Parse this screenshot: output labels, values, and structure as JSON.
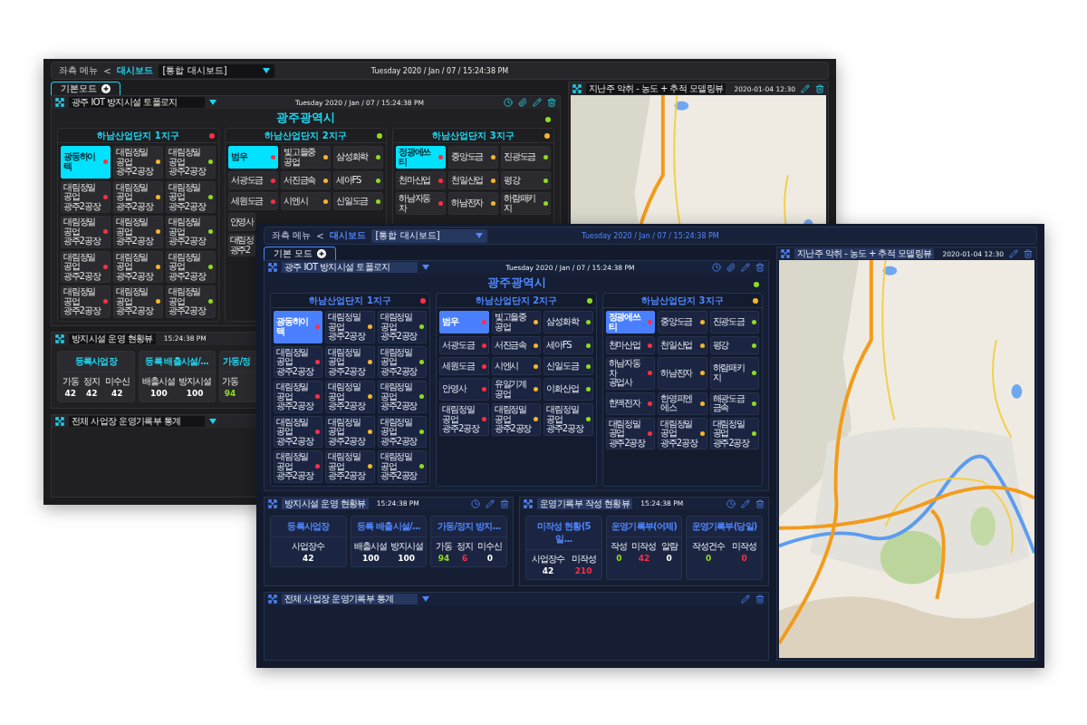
{
  "windows": [
    {
      "kind": "graphite",
      "header": {
        "menu": "좌측 메뉴",
        "separator": "<",
        "crumb": "대시보드",
        "dashboard": "[통합 대시보드]",
        "datetime": "Tuesday 2020 / Jan / 07 / 15:24:38 PM"
      },
      "tabs": [
        {
          "label": "기본모드",
          "selected": true
        }
      ],
      "topology": {
        "title": "광주 IOT 방지시설 토폴로지",
        "datetime": "Tuesday 2020 / Jan / 07 / 15:24:38 PM",
        "region": "광주광역시",
        "color": "#8fdc1e",
        "zones": [
          {
            "title": "하남산업단지 1지구",
            "color": "#ff2e45",
            "rows": [
              [
                {
                  "label": "광동하이텍",
                  "color": "#ff2e45",
                  "selected": true
                },
                {
                  "label": "대림정밀공업\n광주2공장",
                  "color": "#f7b52a",
                  "selected": false
                },
                {
                  "label": "대림정밀공업\n광주2공장",
                  "color": "#8fdc1e",
                  "selected": false
                }
              ],
              [
                {
                  "label": "대림정밀공업\n광주2공장",
                  "color": "#ff2e45",
                  "selected": false
                },
                {
                  "label": "대림정밀공업\n광주2공장",
                  "color": "#f7b52a",
                  "selected": false
                },
                {
                  "label": "대림정밀공업\n광주2공장",
                  "color": "#8fdc1e",
                  "selected": false
                }
              ],
              [
                {
                  "label": "대림정밀공업\n광주2공장",
                  "color": "#ff2e45",
                  "selected": false
                },
                {
                  "label": "대림정밀공업\n광주2공장",
                  "color": "#f7b52a",
                  "selected": false
                },
                {
                  "label": "대림정밀공업\n광주2공장",
                  "color": "#8fdc1e",
                  "selected": false
                }
              ],
              [
                {
                  "label": "대림정밀공업\n광주2공장",
                  "color": "#ff2e45",
                  "selected": false
                },
                {
                  "label": "대림정밀공업\n광주2공장",
                  "color": "#f7b52a",
                  "selected": false
                },
                {
                  "label": "대림정밀공업\n광주2공장",
                  "color": "#8fdc1e",
                  "selected": false
                }
              ],
              [
                {
                  "label": "대림정밀공업\n광주2공장",
                  "color": "#ff2e45",
                  "selected": false
                },
                {
                  "label": "대림정밀공업\n광주2공장",
                  "color": "#f7b52a",
                  "selected": false
                },
                {
                  "label": "대림정밀공업\n광주2공장",
                  "color": "#8fdc1e",
                  "selected": false
                }
              ]
            ]
          },
          {
            "title": "하남산업단지 2지구",
            "color": "#8fdc1e",
            "rows": [
              [
                {
                  "label": "범우",
                  "color": "#ff2e45",
                  "selected": true
                },
                {
                  "label": "빛고을중공업",
                  "color": "#f7b52a",
                  "selected": false
                },
                {
                  "label": "삼성화학",
                  "color": "#8fdc1e",
                  "selected": false
                }
              ],
              [
                {
                  "label": "서광도금",
                  "color": "#ff2e45",
                  "selected": false
                },
                {
                  "label": "서진금속",
                  "color": "#f7b52a",
                  "selected": false
                },
                {
                  "label": "세아FS",
                  "color": "#8fdc1e",
                  "selected": false
                }
              ],
              [
                {
                  "label": "세원도금",
                  "color": "#ff2e45",
                  "selected": false
                },
                {
                  "label": "시엔시",
                  "color": "#f7b52a",
                  "selected": false
                },
                {
                  "label": "신일도금",
                  "color": "#8fdc1e",
                  "selected": false
                }
              ],
              [
                {
                  "kind": "clipped",
                  "label": "안영사",
                  "selected": false
                }
              ],
              [
                {
                  "kind": "clipped",
                  "label": "대림정\n광주2",
                  "selected": false
                }
              ]
            ]
          },
          {
            "title": "하남산업단지 3지구",
            "color": "#f7b52a",
            "rows": [
              [
                {
                  "label": "정광에쓰티",
                  "color": "#ff2e45",
                  "selected": true
                },
                {
                  "label": "중앙도금",
                  "color": "#f7b52a",
                  "selected": false
                },
                {
                  "label": "진광도금",
                  "color": "#8fdc1e",
                  "selected": false
                }
              ],
              [
                {
                  "label": "천마산업",
                  "color": "#ff2e45",
                  "selected": false
                },
                {
                  "label": "천일산업",
                  "color": "#f7b52a",
                  "selected": false
                },
                {
                  "label": "평강",
                  "color": "#8fdc1e",
                  "selected": false
                }
              ],
              [
                {
                  "label": "하남자동차",
                  "color": "#ff2e45",
                  "selected": false
                },
                {
                  "label": "하남전자",
                  "color": "#f7b52a",
                  "selected": false
                },
                {
                  "label": "하람패키지",
                  "color": "#8fdc1e",
                  "selected": false
                }
              ]
            ]
          }
        ]
      },
      "status_panels": [
        {
          "title": "방지시설 운영 현황뷰",
          "time": "15:24:38 PM",
          "cards": [
            {
              "kind": "full",
              "title": "등록사업장",
              "stats": [
                {
                  "label": "가동",
                  "value": "42",
                  "color": "#ffffff"
                },
                {
                  "label": "정지",
                  "value": "42",
                  "color": "#ffffff"
                },
                {
                  "label": "미수신",
                  "value": "42",
                  "color": "#ffffff"
                }
              ]
            },
            {
              "kind": "full",
              "title": "등록 배출시설/...",
              "stats": [
                {
                  "label": "배출시설",
                  "value": "100",
                  "color": "#ffffff"
                },
                {
                  "label": "방지시설",
                  "value": "100",
                  "color": "#ffffff"
                }
              ]
            },
            {
              "kind": "clipped",
              "title": "가동/정",
              "stats": [
                {
                  "label": "가동",
                  "value": "94",
                  "color": "#8fdc1e"
                }
              ]
            }
          ]
        }
      ],
      "statistics": {
        "title": "전체 사업장 운영기록부 통계"
      },
      "map_panel": {
        "title": "지난주 악취 - 농도 + 추적 모델링뷰",
        "datetime": "2020-01-04 12:30"
      }
    },
    {
      "kind": "navy",
      "header": {
        "menu": "좌측 메뉴",
        "separator": "<",
        "crumb": "대시보드",
        "dashboard": "[통합 대시보드]",
        "datetime": "Tuesday 2020 / Jan / 07 / 15:24:38 PM"
      },
      "tabs": [
        {
          "label": "기본 모드",
          "selected": true
        }
      ],
      "topology": {
        "title": "광주 IOT 방지시설 토폴로지",
        "datetime": "Tuesday 2020 / Jan / 07 / 15:24:38 PM",
        "region": "광주광역시",
        "color": "#8fdc1e",
        "zones": [
          {
            "title": "하남산업단지 1지구",
            "color": "#ff2e45",
            "rows": [
              [
                {
                  "label": "광동하이텍",
                  "color": "#ff2e45",
                  "selected": true
                },
                {
                  "label": "대림정밀공업\n광주2공장",
                  "color": "#f7b52a",
                  "selected": false
                },
                {
                  "label": "대림정밀공업\n광주2공장",
                  "color": "#8fdc1e",
                  "selected": false
                }
              ],
              [
                {
                  "label": "대림정밀공업\n광주2공장",
                  "color": "#ff2e45",
                  "selected": false
                },
                {
                  "label": "대림정밀공업\n광주2공장",
                  "color": "#f7b52a",
                  "selected": false
                },
                {
                  "label": "대림정밀공업\n광주2공장",
                  "color": "#8fdc1e",
                  "selected": false
                }
              ],
              [
                {
                  "label": "대림정밀공업\n광주2공장",
                  "color": "#ff2e45",
                  "selected": false
                },
                {
                  "label": "대림정밀공업\n광주2공장",
                  "color": "#f7b52a",
                  "selected": false
                },
                {
                  "label": "대림정밀공업\n광주2공장",
                  "color": "#8fdc1e",
                  "selected": false
                }
              ],
              [
                {
                  "label": "대림정밀공업\n광주2공장",
                  "color": "#ff2e45",
                  "selected": false
                },
                {
                  "label": "대림정밀공업\n광주2공장",
                  "color": "#f7b52a",
                  "selected": false
                },
                {
                  "label": "대림정밀공업\n광주2공장",
                  "color": "#8fdc1e",
                  "selected": false
                }
              ],
              [
                {
                  "label": "대림정밀공업\n광주2공장",
                  "color": "#ff2e45",
                  "selected": false
                },
                {
                  "label": "대림정밀공업\n광주2공장",
                  "color": "#f7b52a",
                  "selected": false
                },
                {
                  "label": "대림정밀공업\n광주2공장",
                  "color": "#8fdc1e",
                  "selected": false
                }
              ]
            ]
          },
          {
            "title": "하남산업단지 2지구",
            "color": "#8fdc1e",
            "rows": [
              [
                {
                  "label": "범우",
                  "color": "#ff2e45",
                  "selected": true
                },
                {
                  "label": "빛고을중공업",
                  "color": "#f7b52a",
                  "selected": false
                },
                {
                  "label": "삼성화학",
                  "color": "#8fdc1e",
                  "selected": false
                }
              ],
              [
                {
                  "label": "서광도금",
                  "color": "#ff2e45",
                  "selected": false
                },
                {
                  "label": "서진금속",
                  "color": "#f7b52a",
                  "selected": false
                },
                {
                  "label": "세아FS",
                  "color": "#8fdc1e",
                  "selected": false
                }
              ],
              [
                {
                  "label": "세원도금",
                  "color": "#ff2e45",
                  "selected": false
                },
                {
                  "label": "시엔시",
                  "color": "#f7b52a",
                  "selected": false
                },
                {
                  "label": "신일도금",
                  "color": "#8fdc1e",
                  "selected": false
                }
              ],
              [
                {
                  "label": "안영사",
                  "color": "#ff2e45",
                  "selected": false
                },
                {
                  "label": "유일기계공업",
                  "color": "#f7b52a",
                  "selected": false
                },
                {
                  "label": "이화산업",
                  "color": "#8fdc1e",
                  "selected": false
                }
              ],
              [
                {
                  "label": "대림정밀공업\n광주2공장",
                  "color": "#ff2e45",
                  "selected": false
                },
                {
                  "label": "대림정밀공업\n광주2공장",
                  "color": "#f7b52a",
                  "selected": false
                },
                {
                  "label": "대림정밀공업\n광주2공장",
                  "color": "#8fdc1e",
                  "selected": false
                }
              ]
            ]
          },
          {
            "title": "하남산업단지 3지구",
            "color": "#f7b52a",
            "rows": [
              [
                {
                  "label": "정광에쓰티",
                  "color": "#ff2e45",
                  "selected": true
                },
                {
                  "label": "중앙도금",
                  "color": "#f7b52a",
                  "selected": false
                },
                {
                  "label": "진광도금",
                  "color": "#8fdc1e",
                  "selected": false
                }
              ],
              [
                {
                  "label": "천마산업",
                  "color": "#ff2e45",
                  "selected": false
                },
                {
                  "label": "천일산업",
                  "color": "#f7b52a",
                  "selected": false
                },
                {
                  "label": "평강",
                  "color": "#8fdc1e",
                  "selected": false
                }
              ],
              [
                {
                  "label": "하남자동차\n공업사",
                  "color": "#ff2e45",
                  "selected": false
                },
                {
                  "label": "하남전자",
                  "color": "#f7b52a",
                  "selected": false
                },
                {
                  "label": "하람패키지",
                  "color": "#8fdc1e",
                  "selected": false
                }
              ],
              [
                {
                  "label": "한맥전자",
                  "color": "#ff2e45",
                  "selected": false
                },
                {
                  "label": "한영피엔에스",
                  "color": "#f7b52a",
                  "selected": false
                },
                {
                  "label": "해광도금금속",
                  "color": "#8fdc1e",
                  "selected": false
                }
              ],
              [
                {
                  "label": "대림정밀공업\n광주2공장",
                  "color": "#ff2e45",
                  "selected": false
                },
                {
                  "label": "대림정밀공업\n광주2공장",
                  "color": "#f7b52a",
                  "selected": false
                },
                {
                  "label": "대림정밀공업\n광주2공장",
                  "color": "#8fdc1e",
                  "selected": false
                }
              ]
            ]
          }
        ]
      },
      "status_panels": [
        {
          "title": "방지시설 운영 현황뷰",
          "time": "15:24:38 PM",
          "cards": [
            {
              "kind": "full",
              "title": "등록사업장",
              "stats": [
                {
                  "label": "사업장수",
                  "value": "42",
                  "color": "#ffffff"
                }
              ]
            },
            {
              "kind": "full",
              "title": "등록 배출시설/...",
              "stats": [
                {
                  "label": "배출시설",
                  "value": "100",
                  "color": "#ffffff"
                },
                {
                  "label": "방지시설",
                  "value": "100",
                  "color": "#ffffff"
                }
              ]
            },
            {
              "kind": "full",
              "title": "가동/정지 방지...",
              "stats": [
                {
                  "label": "가동",
                  "value": "94",
                  "color": "#8fdc1e"
                },
                {
                  "label": "정지",
                  "value": "6",
                  "color": "#ff2e45"
                },
                {
                  "label": "미수신",
                  "value": "0",
                  "color": "#ffffff"
                }
              ]
            }
          ]
        },
        {
          "title": "운영기록부 작성 현황뷰",
          "time": "15:24:38 PM",
          "cards": [
            {
              "kind": "full",
              "title": "미작성 현황(5일...",
              "stats": [
                {
                  "label": "사업장수",
                  "value": "42",
                  "color": "#ffffff"
                },
                {
                  "label": "미작성",
                  "value": "210",
                  "color": "#ff2e45"
                }
              ]
            },
            {
              "kind": "full",
              "title": "운영기록부(어제)",
              "stats": [
                {
                  "label": "작성",
                  "value": "0",
                  "color": "#8fdc1e"
                },
                {
                  "label": "미작성",
                  "value": "42",
                  "color": "#ff2e45"
                },
                {
                  "label": "알람",
                  "value": "0",
                  "color": "#ffffff"
                }
              ]
            },
            {
              "kind": "full",
              "title": "운영기록부(당일)",
              "stats": [
                {
                  "label": "작성건수",
                  "value": "0",
                  "color": "#8fdc1e"
                },
                {
                  "label": "미작성",
                  "value": "0",
                  "color": "#ff2e45"
                }
              ]
            }
          ]
        }
      ],
      "statistics": {
        "title": "전체 사업장 운영기록부 통계"
      },
      "map_panel": {
        "title": "지난주 악취 - 농도 + 추적 모델링뷰",
        "datetime": "2020-01-04 12:30"
      }
    }
  ]
}
